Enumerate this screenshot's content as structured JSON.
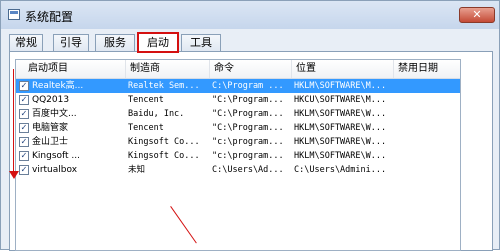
{
  "window": {
    "title": "系统配置",
    "close_glyph": "✕"
  },
  "tabs": [
    {
      "label": "常规"
    },
    {
      "label": "引导"
    },
    {
      "label": "服务"
    },
    {
      "label": "启动",
      "active": true
    },
    {
      "label": "工具"
    }
  ],
  "columns": [
    "启动项目",
    "制造商",
    "命令",
    "位置",
    "禁用日期"
  ],
  "rows": [
    {
      "item": "Realtek高...",
      "maker": "Realtek Sem...",
      "command": "C:\\Program ...",
      "location": "HKLM\\SOFTWARE\\M...",
      "date": "",
      "checked": true,
      "selected": true
    },
    {
      "item": "QQ2013",
      "maker": "Tencent",
      "command": "\"C:\\Program...",
      "location": "HKCU\\SOFTWARE\\M...",
      "date": "",
      "checked": true,
      "selected": false
    },
    {
      "item": "百度中文...",
      "maker": "Baidu, Inc.",
      "command": "\"C:\\Program...",
      "location": "HKLM\\SOFTWARE\\W...",
      "date": "",
      "checked": true,
      "selected": false
    },
    {
      "item": "电脑管家",
      "maker": "Tencent",
      "command": "\"C:\\Program...",
      "location": "HKLM\\SOFTWARE\\W...",
      "date": "",
      "checked": true,
      "selected": false
    },
    {
      "item": "金山卫士",
      "maker": "Kingsoft Co...",
      "command": "\"c:\\program...",
      "location": "HKLM\\SOFTWARE\\W...",
      "date": "",
      "checked": true,
      "selected": false
    },
    {
      "item": "Kingsoft ...",
      "maker": "Kingsoft Co...",
      "command": "\"c:\\program...",
      "location": "HKLM\\SOFTWARE\\W...",
      "date": "",
      "checked": true,
      "selected": false
    },
    {
      "item": "virtualbox",
      "maker": "未知",
      "command": "C:\\Users\\Ad...",
      "location": "C:\\Users\\Admini...",
      "date": "",
      "checked": true,
      "selected": false
    }
  ],
  "colors": {
    "accent": "#d41010",
    "selection": "#3399ff"
  }
}
